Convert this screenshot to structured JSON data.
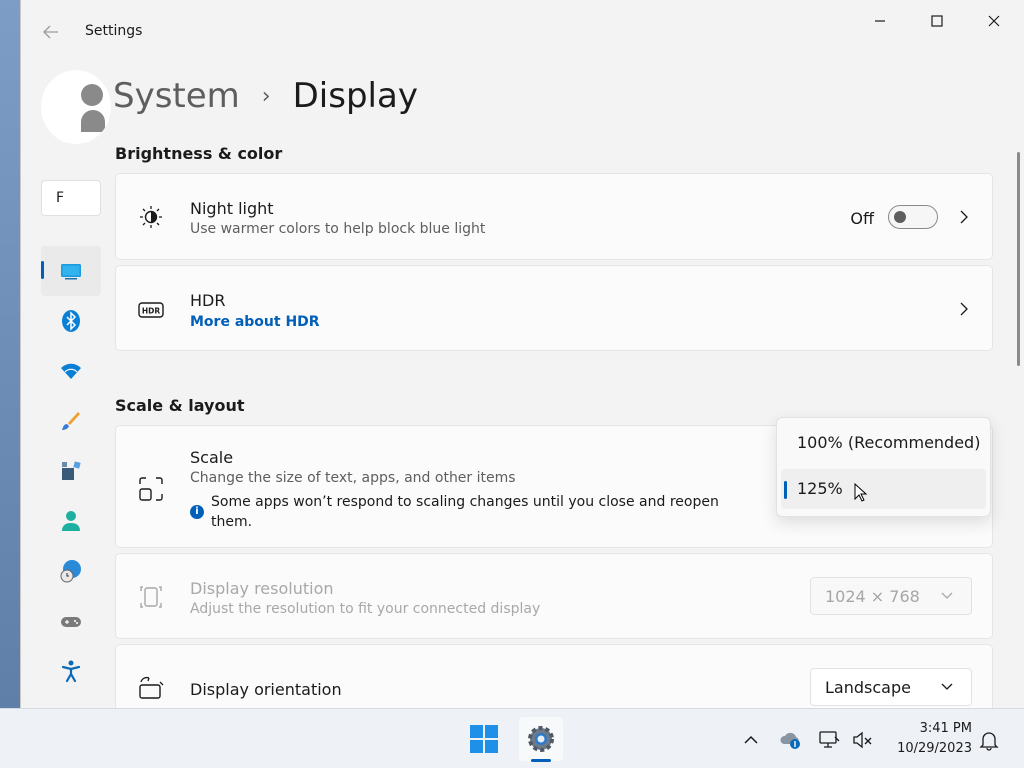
{
  "window": {
    "app_title": "Settings",
    "minimize_glyph": "–",
    "maximize_glyph": "□",
    "close_glyph": "✕"
  },
  "sidebar": {
    "search_text": "F",
    "items": [
      {
        "icon": "system-display-icon",
        "selected": true
      },
      {
        "icon": "bluetooth-icon"
      },
      {
        "icon": "wifi-icon"
      },
      {
        "icon": "personalization-brush-icon"
      },
      {
        "icon": "apps-icon"
      },
      {
        "icon": "accounts-person-icon"
      },
      {
        "icon": "time-language-icon"
      },
      {
        "icon": "gaming-controller-icon"
      },
      {
        "icon": "accessibility-icon"
      }
    ]
  },
  "breadcrumb": {
    "parent": "System",
    "separator": "›",
    "current": "Display"
  },
  "brightness_section": {
    "title": "Brightness & color",
    "night_light": {
      "title": "Night light",
      "description": "Use warmer colors to help block blue light",
      "toggle_state": "Off"
    },
    "hdr": {
      "title": "HDR",
      "link": "More about HDR"
    }
  },
  "scale_section": {
    "title": "Scale & layout",
    "scale": {
      "title": "Scale",
      "description": "Change the size of text, apps, and other items",
      "note": "Some apps won’t respond to scaling changes until you close and reopen them."
    },
    "scale_options": [
      "100% (Recommended)",
      "125%"
    ],
    "scale_selected": "125%",
    "resolution": {
      "title": "Display resolution",
      "description": "Adjust the resolution to fit your connected display",
      "value": "1024 × 768"
    },
    "orientation": {
      "title": "Display orientation",
      "value": "Landscape"
    }
  },
  "taskbar": {
    "time": "3:41 PM",
    "date": "10/29/2023"
  },
  "colors": {
    "accent": "#005fb8",
    "window_bg": "#f3f3f3",
    "card_bg": "#fbfbfb"
  }
}
